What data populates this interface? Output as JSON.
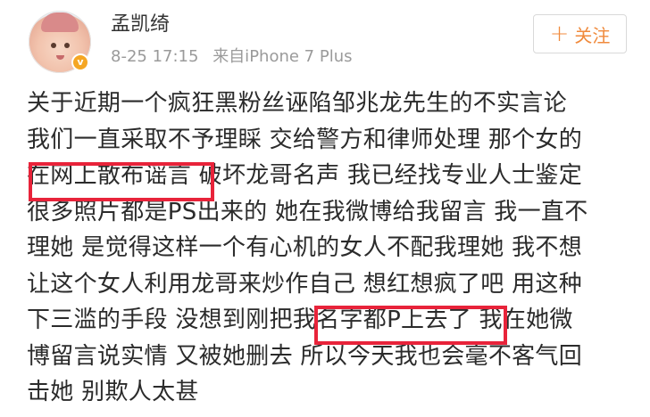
{
  "post": {
    "author": "孟凯绮",
    "verified_badge": "v",
    "meta": {
      "date": "8-25 17:15",
      "source": "来自iPhone 7 Plus"
    },
    "follow_button": {
      "icon": "plus-icon",
      "label": "关注"
    },
    "body_lines": [
      "关于近期一个疯狂黑粉丝诬陷邹兆龙先生的不实言论",
      "我们一直采取不予理睬 交给警方和律师处理 那个女的",
      "在网上散布谣言 破坏龙哥名声 我已经找专业人士鉴定",
      "很多照片都是PS出来的 她在我微博给我留言 我一直不",
      "理她 是觉得这样一个有心机的女人不配我理她 我不想",
      "让这个女人利用龙哥来炒作自己 想红想疯了吧 用这种",
      "下三滥的手段 没想到刚把我名字都P上去了 我在她微",
      "博留言说实情 又被她删去 所以今天我也会毫不客气回",
      "击她 别欺人太甚"
    ],
    "highlights": [
      "在网上散布谣言",
      "名字都P上去了"
    ],
    "highlight_color": "#e8233a",
    "accent_color": "#f08a3c"
  }
}
